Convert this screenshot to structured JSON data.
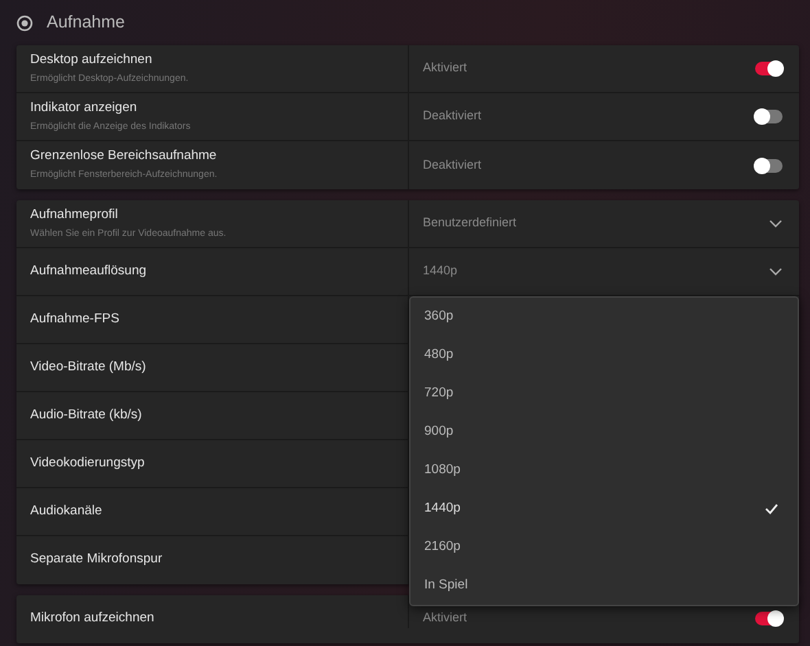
{
  "header": {
    "title": "Aufnahme"
  },
  "groups": [
    {
      "rows": [
        {
          "label": "Desktop aufzeichnen",
          "description": "Ermöglicht Desktop-Aufzeichnungen.",
          "kind": "toggle",
          "value": "Aktiviert",
          "on": true
        },
        {
          "label": "Indikator anzeigen",
          "description": "Ermöglicht die Anzeige des Indikators",
          "kind": "toggle",
          "value": "Deaktiviert",
          "on": false
        },
        {
          "label": "Grenzenlose Bereichsaufnahme",
          "description": "Ermöglicht Fensterbereich-Aufzeichnungen.",
          "kind": "toggle",
          "value": "Deaktiviert",
          "on": false
        }
      ]
    },
    {
      "rows": [
        {
          "label": "Aufnahmeprofil",
          "description": "Wählen Sie ein Profil zur Videoaufnahme aus.",
          "kind": "select",
          "value": "Benutzerdefiniert"
        },
        {
          "label": "Aufnahmeauflösung",
          "kind": "select",
          "value": "1440p",
          "options": [
            {
              "label": "360p",
              "selected": false
            },
            {
              "label": "480p",
              "selected": false
            },
            {
              "label": "720p",
              "selected": false
            },
            {
              "label": "900p",
              "selected": false
            },
            {
              "label": "1080p",
              "selected": false
            },
            {
              "label": "1440p",
              "selected": true
            },
            {
              "label": "2160p",
              "selected": false
            },
            {
              "label": "In Spiel",
              "selected": false
            }
          ]
        },
        {
          "label": "Aufnahme-FPS",
          "kind": "plain"
        },
        {
          "label": "Video-Bitrate (Mb/s)",
          "kind": "plain"
        },
        {
          "label": "Audio-Bitrate (kb/s)",
          "kind": "plain"
        },
        {
          "label": "Videokodierungstyp",
          "kind": "plain"
        },
        {
          "label": "Audiokanäle",
          "kind": "plain"
        },
        {
          "label": "Separate Mikrofonspur",
          "kind": "plain"
        }
      ]
    },
    {
      "rows": [
        {
          "label": "Mikrofon aufzeichnen",
          "kind": "toggle",
          "value": "Aktiviert",
          "on": true
        }
      ]
    }
  ]
}
